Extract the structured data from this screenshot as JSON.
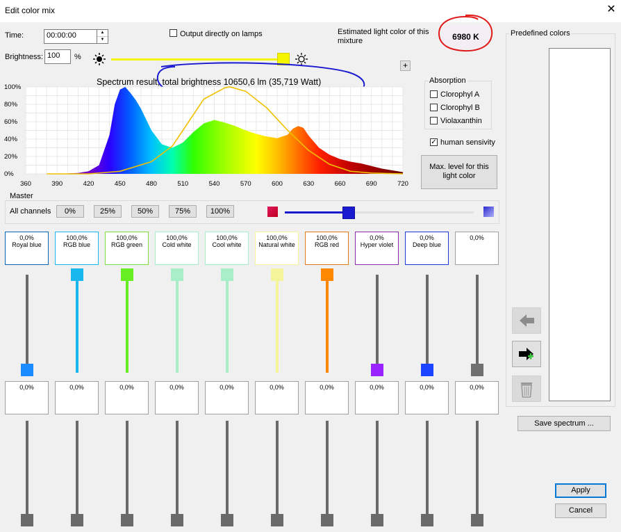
{
  "window": {
    "title": "Edit color mix"
  },
  "controls": {
    "time_label": "Time:",
    "time_value": "00:00:00",
    "brightness_label": "Brightness:",
    "brightness_value": "100",
    "brightness_unit": "%",
    "brightness_level": 1.0,
    "output_label": "Output directly on lamps",
    "estimated_label": "Estimated light color of this mixture",
    "estimated_value": "6980 K",
    "plus": "+"
  },
  "chart_data": {
    "type": "area",
    "title": "Spectrum result, total brightness 10650,6 lm (35,719 Watt)",
    "x_ticks": [
      "360",
      "390",
      "420",
      "450",
      "480",
      "510",
      "540",
      "570",
      "600",
      "630",
      "660",
      "690",
      "720"
    ],
    "y_ticks": [
      "100%",
      "80%",
      "60%",
      "40%",
      "20%",
      "0%"
    ],
    "xlim": [
      360,
      720
    ],
    "ylim": [
      0,
      100
    ],
    "grid": true,
    "series": [
      {
        "kind": "spectrum",
        "x": [
          360,
          390,
          410,
          420,
          430,
          440,
          445,
          450,
          455,
          460,
          465,
          470,
          480,
          490,
          500,
          510,
          520,
          530,
          540,
          550,
          560,
          570,
          580,
          590,
          600,
          610,
          615,
          620,
          625,
          630,
          640,
          650,
          660,
          670,
          680,
          690,
          700,
          710,
          720
        ],
        "y": [
          0,
          0,
          1,
          3,
          10,
          45,
          80,
          97,
          100,
          93,
          85,
          75,
          50,
          34,
          30,
          36,
          48,
          58,
          62,
          59,
          55,
          50,
          46,
          43,
          41,
          45,
          52,
          55,
          53,
          44,
          30,
          22,
          17,
          14,
          12,
          9,
          6,
          4,
          2
        ]
      },
      {
        "kind": "sensitivity",
        "x": [
          380,
          420,
          450,
          480,
          500,
          510,
          530,
          550,
          555,
          570,
          590,
          610,
          630,
          650,
          670,
          690,
          720
        ],
        "y": [
          0,
          0,
          3,
          14,
          32,
          50,
          86,
          99,
          100,
          95,
          76,
          50,
          27,
          11,
          3,
          1,
          0
        ]
      }
    ]
  },
  "absorption": {
    "title": "Absorption",
    "items": [
      {
        "label": "Clorophyl A",
        "checked": false
      },
      {
        "label": "Clorophyl B",
        "checked": false
      },
      {
        "label": "Violaxanthin",
        "checked": false
      }
    ]
  },
  "human": {
    "label": "human sensivity",
    "checked": true,
    "mark": "✓"
  },
  "max_button": "Max. level for this light color",
  "master": {
    "title": "Master",
    "all_channels": "All channels",
    "presets": [
      "0%",
      "25%",
      "50%",
      "75%",
      "100%"
    ],
    "level": 0.34
  },
  "channels": [
    {
      "value": "0,0%",
      "name": "Royal blue",
      "color": "#0a64b4",
      "thumb": "#1a8cff",
      "level": 0.0
    },
    {
      "value": "100,0%",
      "name": "RGB blue",
      "color": "#18b8ee",
      "thumb": "#18b8ee",
      "level": 1.0
    },
    {
      "value": "100,0%",
      "name": "RGB green",
      "color": "#80e040",
      "thumb": "#66ee22",
      "level": 1.0
    },
    {
      "value": "100,0%",
      "name": "Cold white",
      "color": "#a8eec8",
      "thumb": "#a8eec8",
      "level": 1.0
    },
    {
      "value": "100,0%",
      "name": "Cool white",
      "color": "#a8eec8",
      "thumb": "#a8eec8",
      "level": 1.0
    },
    {
      "value": "100,0%",
      "name": "Natural white",
      "color": "#f4f49a",
      "thumb": "#f4f49a",
      "level": 1.0
    },
    {
      "value": "100,0%",
      "name": "RGB red",
      "color": "#e07a1a",
      "thumb": "#ff8800",
      "level": 1.0
    },
    {
      "value": "0,0%",
      "name": "Hyper violet",
      "color": "#8a2aa8",
      "thumb": "#9922ff",
      "level": 0.0
    },
    {
      "value": "0,0%",
      "name": "Deep blue",
      "color": "#1a3ad8",
      "thumb": "#1a44ff",
      "level": 0.0
    },
    {
      "value": "0,0%",
      "name": "",
      "color": "#a0a0a0",
      "thumb": "#707070",
      "level": 0.0
    }
  ],
  "channels2": [
    "0,0%",
    "0,0%",
    "0,0%",
    "0,0%",
    "0,0%",
    "0,0%",
    "0,0%",
    "0,0%",
    "0,0%",
    "0,0%"
  ],
  "predefined": {
    "title": "Predefined colors"
  },
  "buttons": {
    "save": "Save spectrum ...",
    "apply": "Apply",
    "cancel": "Cancel"
  },
  "icons": {
    "sun_dark": "sun-icon",
    "sun_light": "sun-outline-icon",
    "back": "arrow-left-icon",
    "add": "arrow-add-icon",
    "trash": "trash-icon"
  },
  "colors": {
    "yellow": "#f5f500",
    "blue_annot": "#1a1ad0",
    "red_annot": "#e01818"
  }
}
